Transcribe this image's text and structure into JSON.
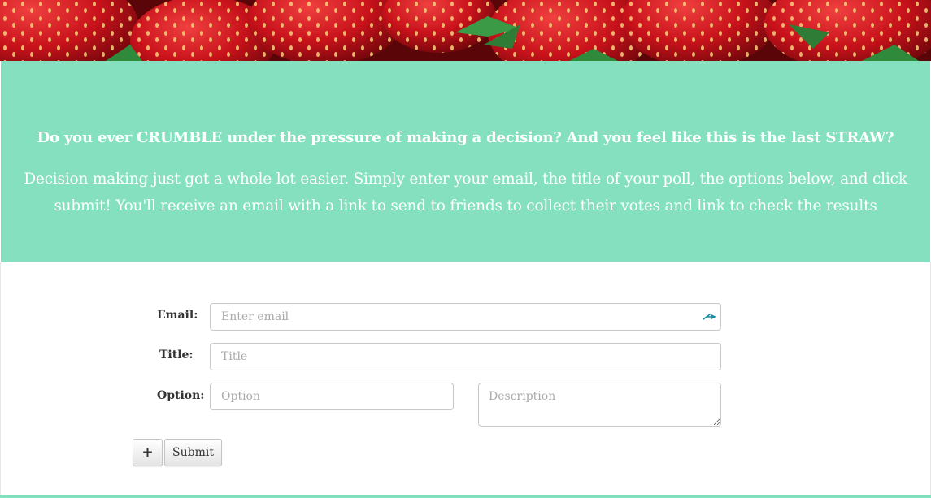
{
  "colors": {
    "hero_bg": "#84e0be",
    "hero_text": "#ffffff",
    "banner_red": "#c4141c"
  },
  "banner": {
    "image": "strawberries-photo"
  },
  "hero": {
    "title": "Do you ever CRUMBLE under the pressure of making a decision? And you feel like this is the last STRAW?",
    "body": "Decision making just got a whole lot easier. Simply enter your email, the title of your poll, the options below, and click submit! You'll receive an email with a link to send to friends to collect their votes and link to check the results"
  },
  "form": {
    "email_label": "Email:",
    "email_placeholder": "Enter email",
    "title_label": "Title:",
    "title_placeholder": "Title",
    "option_label": "Option:",
    "option_placeholder": "Option",
    "description_placeholder": "Description",
    "add_button_label": "+",
    "submit_label": "Submit"
  }
}
